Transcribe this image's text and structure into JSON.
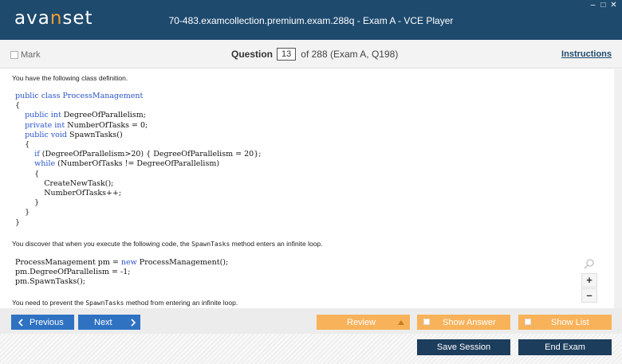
{
  "titlebar": {
    "logo_text": "avanset",
    "title": "70-483.examcollection.premium.exam.288q - Exam A - VCE Player",
    "controls": {
      "minimize": "–",
      "maximize": "□",
      "close": "✕"
    }
  },
  "question_header": {
    "mark_label": "Mark",
    "question_label": "Question",
    "question_number": "13",
    "of_text": "of 288 (Exam A, Q198)",
    "instructions_label": "Instructions"
  },
  "content": {
    "intro": "You have the following class definition.",
    "discover_pre": "You discover that when you execute the following code, the ",
    "discover_code": "SpawnTasks",
    "discover_post": " method enters an infinite loop.",
    "prevent_pre": "You need to prevent the ",
    "prevent_code": "SpawnTasks",
    "prevent_post": " method from entering an infinite loop."
  },
  "zoom": {
    "in": "+",
    "out": "–"
  },
  "nav": {
    "previous": "Previous",
    "next": "Next",
    "review": "Review",
    "show_answer": "Show Answer",
    "show_list": "Show List"
  },
  "footer": {
    "save_session": "Save Session",
    "end_exam": "End Exam"
  },
  "colors": {
    "titlebar": "#1e4a6e",
    "blue_button": "#2f72c2",
    "orange_button": "#f8b25a",
    "dark_button": "#1c3d5c",
    "keyword": "#2b54c8"
  }
}
